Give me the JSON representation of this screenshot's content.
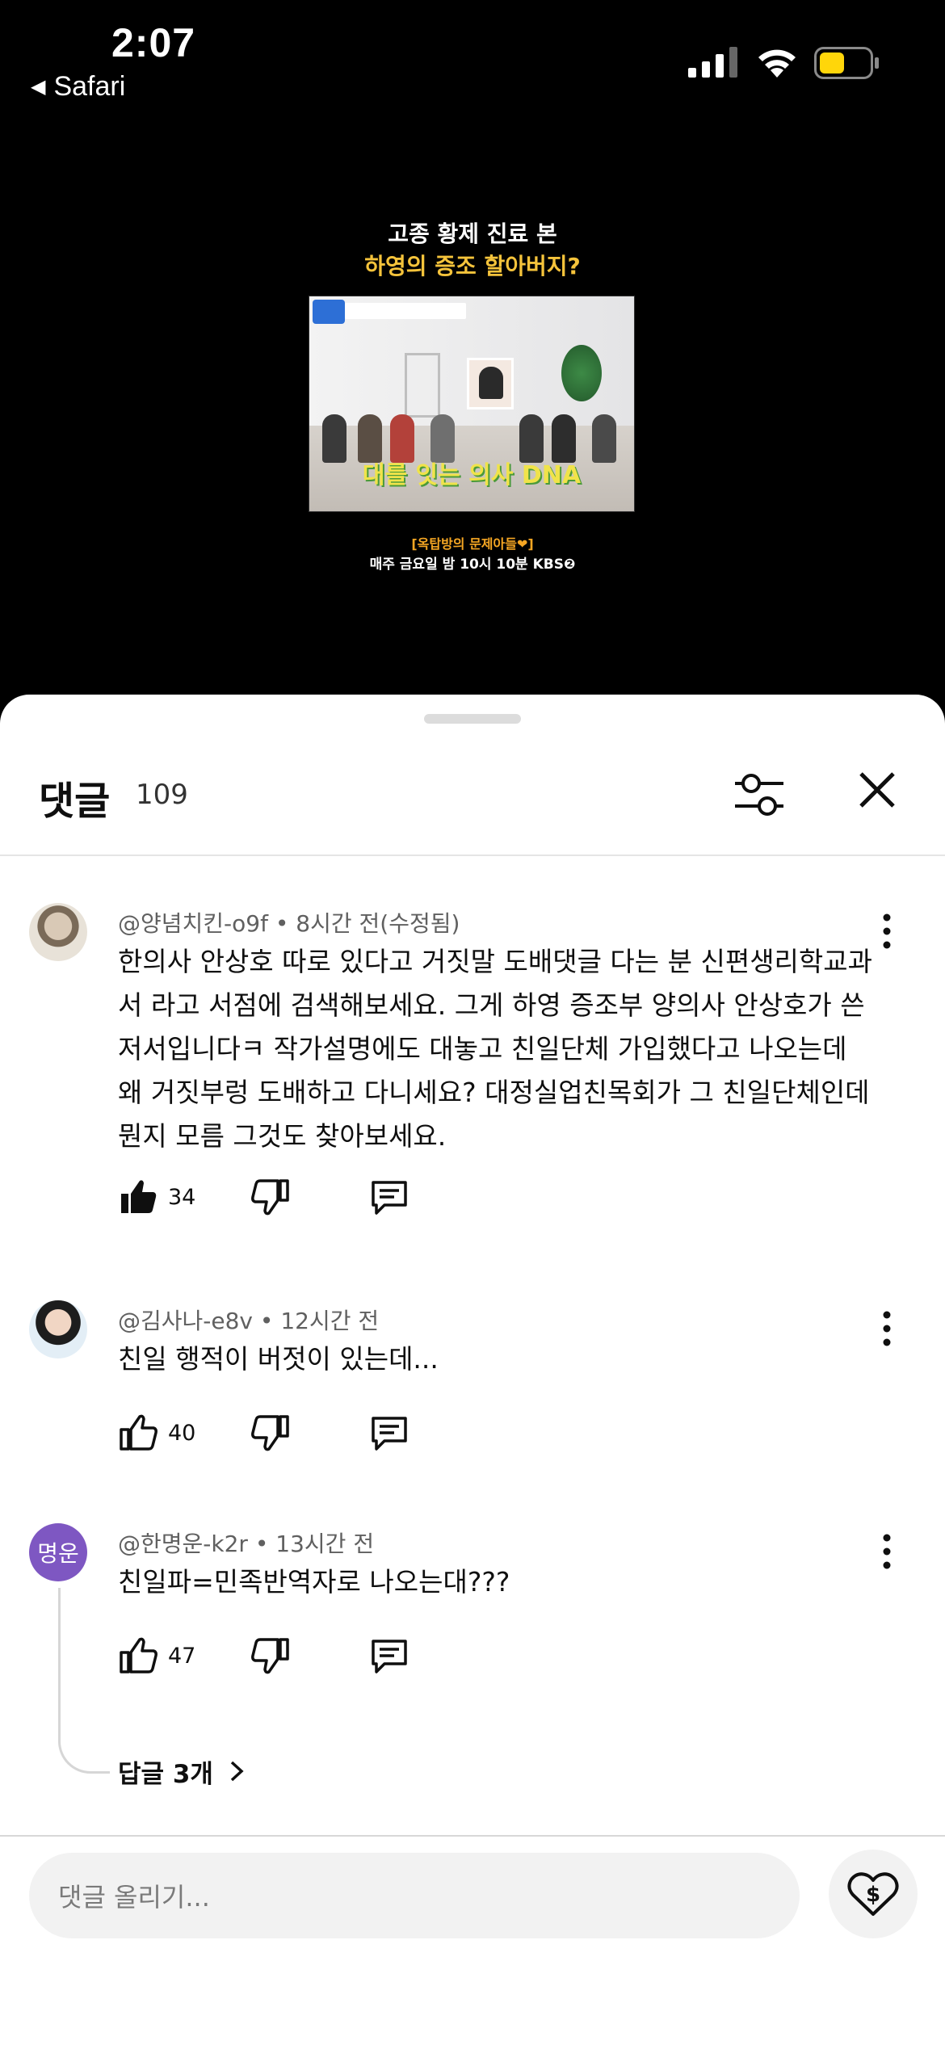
{
  "status": {
    "time": "2:07",
    "back_app": "Safari"
  },
  "video": {
    "line1": "고종 황제 진료 본",
    "line2": "하영의 증조 할아버지?",
    "overlay": "대를 잇는 의사 DNA",
    "promo": "[옥탑방의 문제아들❤]",
    "schedule": "매주 금요일 밤 10시 10분 KBS❷"
  },
  "header": {
    "title": "댓글",
    "count": "109"
  },
  "comments": [
    {
      "author": "@양념치킨-o9f",
      "time": "8시간 전(수정됨)",
      "text": "한의사 안상호 따로 있다고 거짓말 도배댓글 다는 분 신편생리학교과서 라고 서점에 검색해보세요. 그게 하영 증조부 양의사 안상호가 쓴 저서입니다ㅋ 작가설명에도 대놓고 친일단체 가입했다고 나오는데 왜 거짓부렁 도배하고 다니세요? 대정실업친목회가 그 친일단체인데 뭔지 모름 그것도 찾아보세요.",
      "likes": "34",
      "liked": true
    },
    {
      "author": "@김사나-e8v",
      "time": "12시간 전",
      "text": "친일 행적이 버젓이 있는데...",
      "likes": "40",
      "liked": false
    },
    {
      "author": "@한명운-k2r",
      "time": "13시간 전",
      "text": "친일파=민족반역자로 나오는대???",
      "likes": "47",
      "liked": false,
      "avatar_initials": "명운",
      "avatar_color": "#7e57c2",
      "replies_label": "답글 3개"
    }
  ],
  "composer": {
    "placeholder": "댓글 올리기..."
  },
  "colors": {
    "accent_yellow": "#f5c33b",
    "battery": "#ffd60a"
  }
}
